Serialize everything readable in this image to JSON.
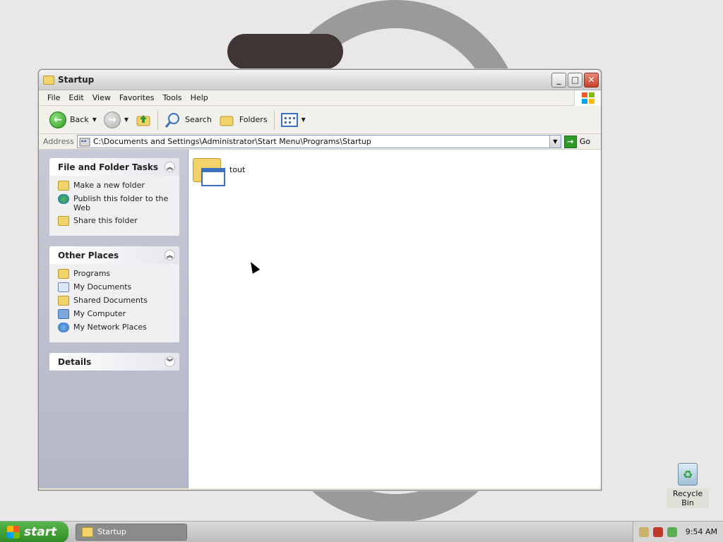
{
  "window": {
    "title": "Startup",
    "menu": [
      "File",
      "Edit",
      "View",
      "Favorites",
      "Tools",
      "Help"
    ],
    "toolbar": {
      "back_label": "Back",
      "search_label": "Search",
      "folders_label": "Folders"
    },
    "address": {
      "label": "Address",
      "value": "C:\\Documents and Settings\\Administrator\\Start Menu\\Programs\\Startup",
      "go_label": "Go"
    }
  },
  "left_pane": {
    "file_tasks": {
      "title": "File and Folder Tasks",
      "items": [
        "Make a new folder",
        "Publish this folder to the Web",
        "Share this folder"
      ]
    },
    "other_places": {
      "title": "Other Places",
      "items": [
        "Programs",
        "My Documents",
        "Shared Documents",
        "My Computer",
        "My Network Places"
      ]
    },
    "details": {
      "title": "Details"
    }
  },
  "content": {
    "items": [
      {
        "name": "tout",
        "icon": "program-group-folder-icon"
      }
    ]
  },
  "desktop": {
    "recycle_bin_label": "Recycle Bin"
  },
  "taskbar": {
    "start_label": "start",
    "task_button_label": "Startup",
    "time": "9:54 AM"
  }
}
